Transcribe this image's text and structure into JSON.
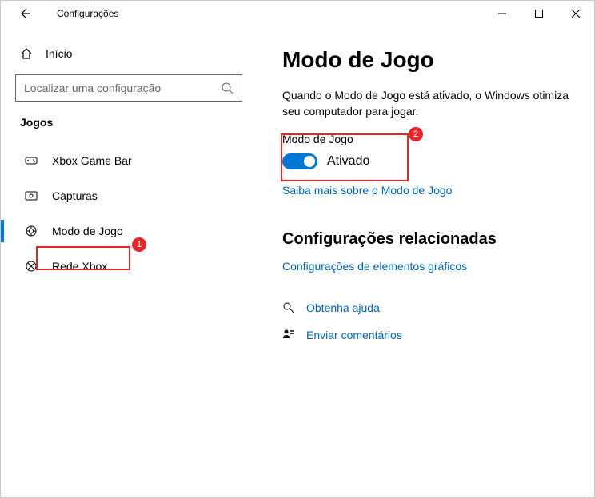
{
  "titlebar": {
    "title": "Configurações"
  },
  "sidebar": {
    "home": "Início",
    "search_placeholder": "Localizar uma configuração",
    "section": "Jogos",
    "items": [
      {
        "label": "Xbox Game Bar"
      },
      {
        "label": "Capturas"
      },
      {
        "label": "Modo de Jogo"
      },
      {
        "label": "Rede Xbox"
      }
    ]
  },
  "annotations": {
    "badge1": "1",
    "badge2": "2"
  },
  "main": {
    "heading": "Modo de Jogo",
    "description": "Quando o Modo de Jogo está ativado, o Windows otimiza seu computador para jogar.",
    "toggle_label": "Modo de Jogo",
    "toggle_state": "Ativado",
    "learn_more": "Saiba mais sobre o Modo de Jogo",
    "related_heading": "Configurações relacionadas",
    "related_link": "Configurações de elementos gráficos",
    "help": "Obtenha ajuda",
    "feedback": "Enviar comentários"
  }
}
